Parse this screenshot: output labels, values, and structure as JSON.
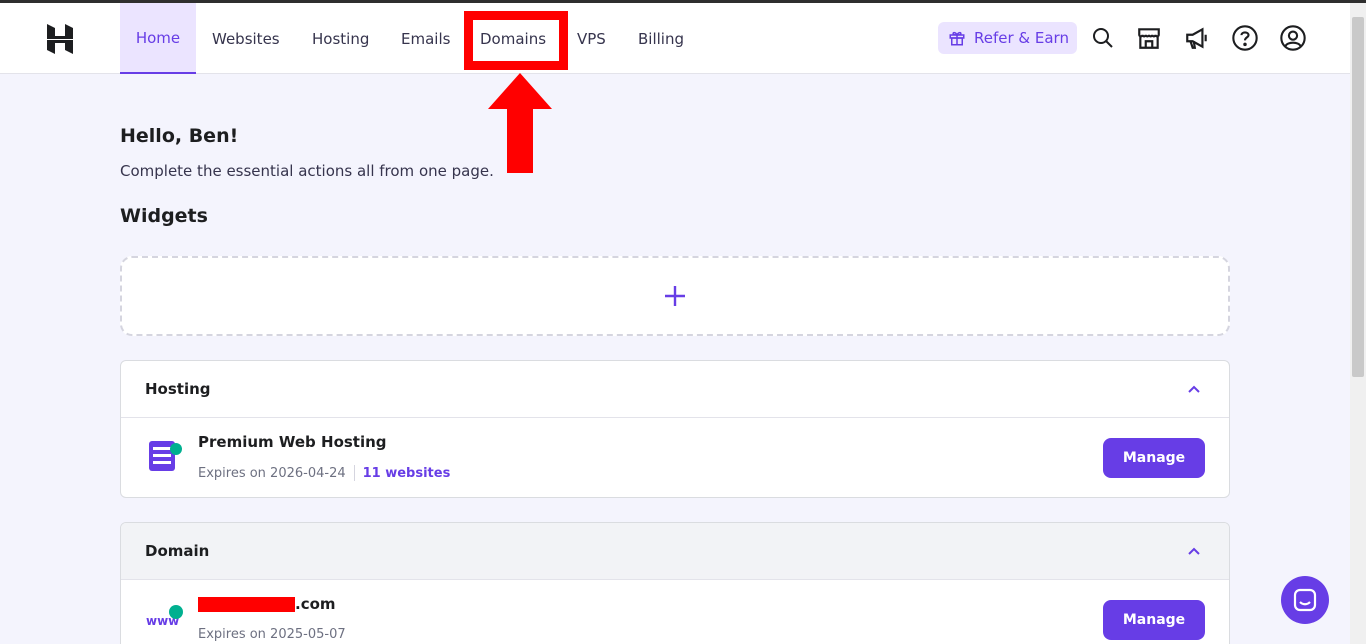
{
  "nav": {
    "items": [
      {
        "label": "Home"
      },
      {
        "label": "Websites"
      },
      {
        "label": "Hosting"
      },
      {
        "label": "Emails"
      },
      {
        "label": "Domains"
      },
      {
        "label": "VPS"
      },
      {
        "label": "Billing"
      }
    ],
    "active": "Home",
    "highlighted": "Domains",
    "refer_label": "Refer & Earn",
    "icons": [
      "search-icon",
      "store-icon",
      "megaphone-icon",
      "help-icon",
      "account-icon"
    ]
  },
  "greeting": {
    "title": "Hello, Ben!",
    "subtitle": "Complete the essential actions all from one page."
  },
  "widgets": {
    "title": "Widgets",
    "add_icon": "plus-icon"
  },
  "hosting_card": {
    "title": "Hosting",
    "plan": "Premium Web Hosting",
    "expires": "Expires on 2026-04-24",
    "websites_link": "11 websites",
    "manage_label": "Manage"
  },
  "domain_card": {
    "title": "Domain",
    "domain_suffix": ".com",
    "expires": "Expires on 2025-05-07",
    "manage_label": "Manage"
  },
  "colors": {
    "accent": "#673de6",
    "highlight_red": "#ff0000"
  }
}
